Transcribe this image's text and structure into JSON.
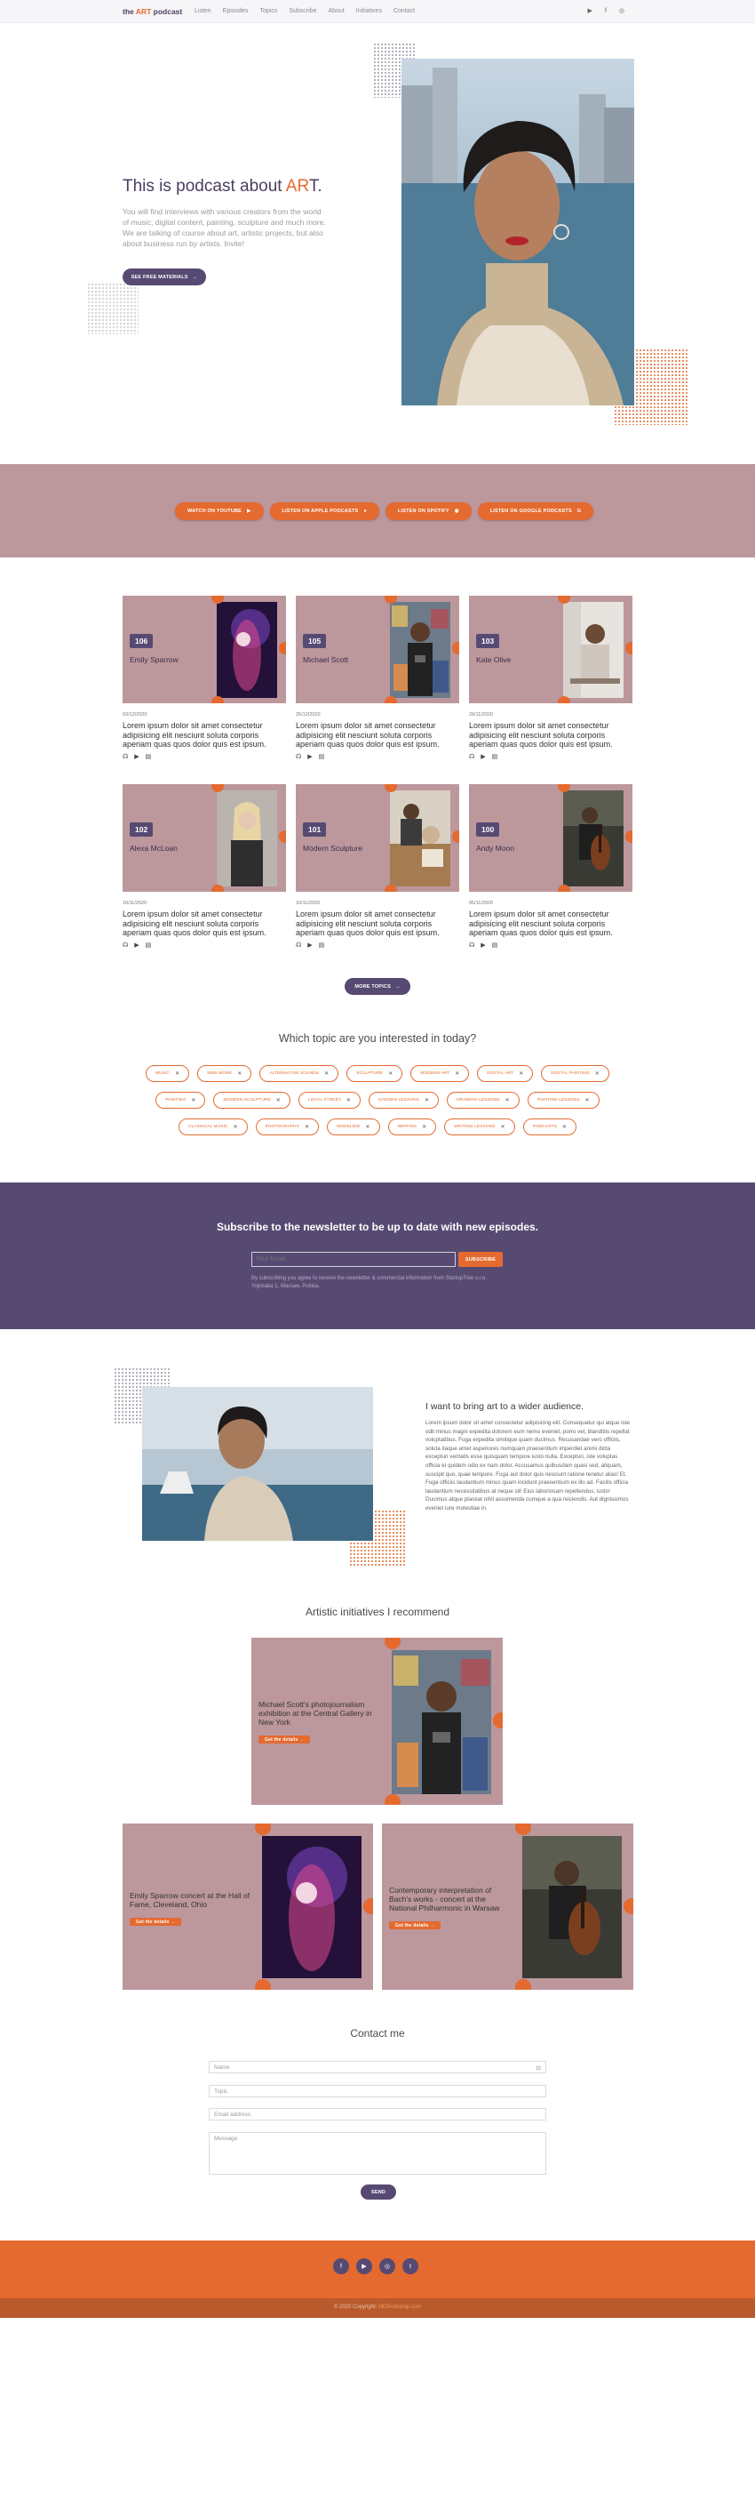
{
  "nav": {
    "logo_pre": "the ",
    "logo_art": "ART",
    "logo_post": " podcast",
    "items": [
      "Listen",
      "Episodes",
      "Topics",
      "Subscribe",
      "About",
      "Initiatives",
      "Contact"
    ],
    "social": [
      "youtube-icon",
      "facebook-icon",
      "instagram-icon"
    ]
  },
  "hero": {
    "title_pre": "This is podcast about ",
    "title_a": "AR",
    "title_t": "T.",
    "description": "You will find interviews with various creators from the world of music, digital content, painting, sculpture and much more. We are talking of course about art, artistic projects, but also about business run by artists. Invite!",
    "button": "SEE FREE MATERIALS",
    "button_arrow": "→"
  },
  "listen": {
    "buttons": [
      {
        "label": "WATCH ON YOUTUBE",
        "icon": "youtube-icon",
        "glyph": "▶"
      },
      {
        "label": "LISTEN ON APPLE PODCASTS",
        "icon": "apple-podcasts-icon",
        "glyph": "●"
      },
      {
        "label": "LISTEN ON SPOTIFY",
        "icon": "spotify-icon",
        "glyph": "◉"
      },
      {
        "label": "LISTEN ON GOOGLE PODCASTS",
        "icon": "google-icon",
        "glyph": "G"
      }
    ]
  },
  "episodes": [
    {
      "num": "106",
      "name": "Emily Sparrow",
      "date": "03/12/2020",
      "text": "Lorem ipsum dolor sit amet consectetur adipisicing elit nesciunt soluta corporis aperiam quas quos dolor quis est ipsum."
    },
    {
      "num": "105",
      "name": "Michael Scott",
      "date": "25/12/2020",
      "text": "Lorem ipsum dolor sit amet consectetur adipisicing elit nesciunt soluta corporis aperiam quas quos dolor quis est ipsum."
    },
    {
      "num": "103",
      "name": "Kate Olive",
      "date": "28/11/2020",
      "text": "Lorem ipsum dolor sit amet consectetur adipisicing elit nesciunt soluta corporis aperiam quas quos dolor quis est ipsum."
    },
    {
      "num": "102",
      "name": "Alexa McLoan",
      "date": "18/11/2020",
      "text": "Lorem ipsum dolor sit amet consectetur adipisicing elit nesciunt soluta corporis aperiam quas quos dolor quis est ipsum."
    },
    {
      "num": "101",
      "name": "Modern Sculpture",
      "date": "10/11/2020",
      "text": "Lorem ipsum dolor sit amet consectetur adipisicing elit nesciunt soluta corporis aperiam quas quos dolor quis est ipsum."
    },
    {
      "num": "100",
      "name": "Andy Moon",
      "date": "05/11/2020",
      "text": "Lorem ipsum dolor sit amet consectetur adipisicing elit nesciunt soluta corporis aperiam quas quos dolor quis est ipsum."
    }
  ],
  "more_topics": "MORE TOPICS",
  "topics": {
    "title": "Which topic are you interested in today?",
    "row1": [
      "MUSIC",
      "WEB WORK",
      "ALTERNATIVE SOUNDS",
      "SCULPTURE",
      "MODERN ART",
      "DIGITAL ART",
      "DIGITAL PAINTING"
    ],
    "row2": [
      "PAINTING",
      "MODERN SCULPTURE",
      "LOCAL STREET",
      "GARDEN LESSONS",
      "DRAWING LESSONS",
      "PAINTING LESSONS"
    ],
    "row3": [
      "CLASSICAL MUSIC",
      "PHOTOGRAPHY",
      "MODELING",
      "WRITING",
      "WRITING LESSONS",
      "PODCASTS"
    ]
  },
  "newsletter": {
    "title": "Subscribe to the newsletter to be up to date with new episodes.",
    "placeholder": "Your Email",
    "button": "SUBSCRIBE",
    "note": "By subscribing you agree to receive the newsletter & commercial information from StartupTree s.r.o. Yojimaba 1, Warsaw, Polska."
  },
  "about": {
    "title": "I want to bring art to a wider audience.",
    "text": "Lorem ipsum dolor sit amet consectetur adipisicing elit. Consequatur qui atque iste odit minus magni expedita dolorem eum nemo eveniet, porro vel, blanditiis repellat voluptatibus. Fuga expedita similique quam ducimus. Recusandae vero officiis, soluta itaque amet asperiores numquam praesentium imperdiet animi dicta excepturi veritatis esse quisquam tempore iusto nulla. Excepturi, iste voluptas officia et quidem odio ex nam dolor. Accusamus quibusdam quasi sed, aliquam, suscipit quo, quae tempore. Fuga aut dolor quis nesciunt ratione tenetur alias! Et. Fuga officiis laudantium minus quam incidunt praesentium ex illo ad. Facilis officia laudantium necessitatibus at neque sit! Eius laboriosam repellendus, iusto! Ducimus atque placeat nihil assumenda cumque a qua reiciendis. Aut dignissimos eveniet iure molestiae in."
  },
  "initiatives": {
    "title": "Artistic initiatives I recommend",
    "items": [
      {
        "title": "Michael Scott's photojournalism exhibition at the Central Gallery in New York",
        "button": "Get the details"
      },
      {
        "title": "Emily Sparrow concert at the Hall of Fame, Cleveland, Ohio",
        "button": "Get the details"
      },
      {
        "title": "Contemporary interpretation of Bach's works - concert at the National Philharmonic in Warsaw",
        "button": "Get the details"
      }
    ]
  },
  "contact": {
    "title": "Contact me",
    "name": "Name",
    "topic": "Topic",
    "email": "Email address",
    "message": "Message",
    "send": "SEND"
  },
  "footer": {
    "social": [
      "facebook-icon",
      "youtube-icon",
      "instagram-icon",
      "twitter-icon"
    ],
    "copy_pre": "© 2020 Copyright: ",
    "copy_link": "MDBootstrap.com"
  },
  "colors": {
    "accent": "#e46a2f",
    "primary": "#574a72",
    "mauve": "#bc979c"
  }
}
